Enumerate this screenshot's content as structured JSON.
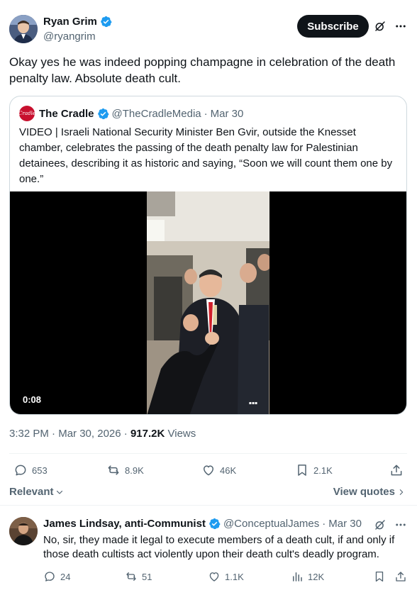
{
  "author": {
    "display_name": "Ryan Grim",
    "handle": "@ryangrim",
    "verified": true
  },
  "header_actions": {
    "subscribe_label": "Subscribe",
    "grok_icon": "grok-icon",
    "more_icon": "more-icon"
  },
  "tweet": {
    "text": "Okay yes he was indeed popping champagne in celebration of the death penalty law. Absolute death cult."
  },
  "quote": {
    "avatar_text": "Cradle",
    "display_name": "The Cradle",
    "handle": "@TheCradleMedia",
    "separator": "·",
    "date": "Mar 30",
    "text": "VIDEO | Israeli National Security Minister Ben Gvir, outside the Knesset chamber, celebrates the passing of the death penalty law for Palestinian detainees, describing it as historic and saying, “Soon we will count them one by one.”",
    "video_duration": "0:08"
  },
  "meta": {
    "time": "3:32 PM",
    "separator": "·",
    "date": "Mar 30, 2026",
    "views_count": "917.2K",
    "views_label": "Views"
  },
  "actions": {
    "replies": "653",
    "reposts": "8.9K",
    "likes": "46K",
    "bookmarks": "2.1K"
  },
  "sort": {
    "label": "Relevant",
    "view_quotes_label": "View quotes"
  },
  "reply": {
    "display_name": "James Lindsay, anti-Communist",
    "handle": "@ConceptualJames",
    "separator": "·",
    "date": "Mar 30",
    "text": "No, sir, they made it legal to execute members of a death cult, if and only if those death cultists act violently upon their death cult's deadly program.",
    "replies": "24",
    "reposts": "51",
    "likes": "1.1K",
    "views": "12K"
  },
  "colors": {
    "primary_text": "#0f1419",
    "secondary_text": "#536471",
    "verified_blue": "#1d9bf0",
    "border": "#cfd9de"
  }
}
